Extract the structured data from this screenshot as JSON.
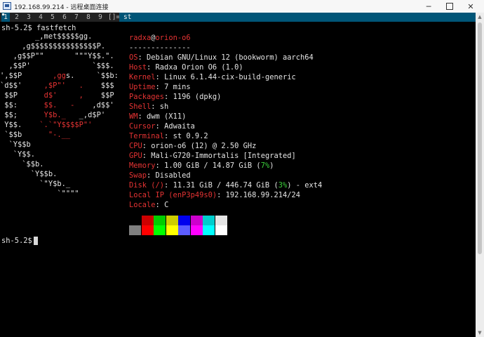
{
  "window": {
    "title": "192.168.99.214 - 远程桌面连接",
    "minimize_glyph": "─",
    "close_glyph": "✕"
  },
  "dwm": {
    "tags": [
      "1",
      "2",
      "3",
      "4",
      "5",
      "6",
      "7",
      "8",
      "9"
    ],
    "selected_tag": "1",
    "layout": "[]=",
    "window_title": "st"
  },
  "terminal": {
    "prompt1": "sh-5.2$ fastfetch",
    "prompt2": "sh-5.2$ ",
    "logo": [
      "        _,met$$$$$gg.",
      "     ,g$$$$$$$$$$$$$$$P.",
      "   ,g$$P\"\"       \"\"\"Y$$.\".",
      "  ,$$P'              `$$$.",
      "',$$P       ,ggs.     `$$b:",
      "`d$$'     ,$P\"'   .    $$$",
      " $$P      d$'     ,    $$P",
      " $$:      $$.   -    ,d$$'",
      " $$;      Y$b._   _,d$P'",
      " Y$$.    `.`\"Y$$$$P\"'",
      " `$$b      \"-.__",
      "  `Y$$b",
      "   `Y$$.",
      "     `$$b.",
      "       `Y$$b.",
      "         `\"Y$b._",
      "             `\"\"\"\""
    ],
    "user": "radxa",
    "at": "@",
    "host": "orion-o6",
    "separator": "--------------",
    "info": [
      {
        "key": "OS",
        "value": "Debian GNU/Linux 12 (bookworm) aarch64"
      },
      {
        "key": "Host",
        "value": "Radxa Orion O6 (1.0)"
      },
      {
        "key": "Kernel",
        "value": "Linux 6.1.44-cix-build-generic"
      },
      {
        "key": "Uptime",
        "value": "7 mins"
      },
      {
        "key": "Packages",
        "value": "1196 (dpkg)"
      },
      {
        "key": "Shell",
        "value": "sh"
      },
      {
        "key": "WM",
        "value": "dwm (X11)"
      },
      {
        "key": "Cursor",
        "value": "Adwaita"
      },
      {
        "key": "Terminal",
        "value": "st 0.9.2"
      },
      {
        "key": "CPU",
        "value": "orion-o6 (12) @ 2.50 GHz"
      },
      {
        "key": "GPU",
        "value": "Mali-G720-Immortalis [Integrated]"
      },
      {
        "key": "Memory",
        "value": "1.00 GiB / 14.87 GiB (",
        "pct": "7%",
        "tail": ")"
      },
      {
        "key": "Swap",
        "value": "Disabled"
      },
      {
        "key": "Disk (/)",
        "value": "11.31 GiB / 446.74 GiB (",
        "pct": "3%",
        "tail": ") - ext4"
      },
      {
        "key": "Local IP (enP3p49s0)",
        "value": "192.168.99.214/24"
      },
      {
        "key": "Locale",
        "value": "C"
      }
    ],
    "palette_top": [
      "#000000",
      "#cd0000",
      "#00cd00",
      "#cdcd00",
      "#0000ee",
      "#cd00cd",
      "#00cdcd",
      "#e5e5e5"
    ],
    "palette_bottom": [
      "#7f7f7f",
      "#ff0000",
      "#00ff00",
      "#ffff00",
      "#5c5cff",
      "#ff00ff",
      "#00ffff",
      "#ffffff"
    ]
  }
}
